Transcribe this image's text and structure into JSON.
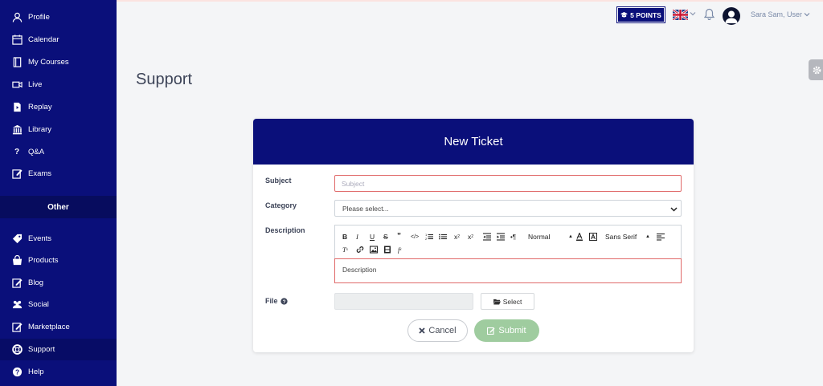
{
  "sidebar": {
    "items": [
      {
        "label": "Profile",
        "icon": "user-icon"
      },
      {
        "label": "Calendar",
        "icon": "calendar-icon"
      },
      {
        "label": "My Courses",
        "icon": "book-icon"
      },
      {
        "label": "Live",
        "icon": "video-icon"
      },
      {
        "label": "Replay",
        "icon": "replay-icon"
      },
      {
        "label": "Library",
        "icon": "library-icon"
      },
      {
        "label": "Q&A",
        "icon": "question-icon"
      },
      {
        "label": "Exams",
        "icon": "edit-icon"
      }
    ],
    "section_other": "Other",
    "other_items": [
      {
        "label": "Events",
        "icon": "tag-icon"
      },
      {
        "label": "Products",
        "icon": "products-icon"
      },
      {
        "label": "Blog",
        "icon": "blog-icon"
      },
      {
        "label": "Social",
        "icon": "users-icon"
      },
      {
        "label": "Marketplace",
        "icon": "marketplace-icon"
      },
      {
        "label": "Support",
        "icon": "lifebuoy-icon",
        "active": true
      },
      {
        "label": "Help",
        "icon": "help-icon"
      }
    ]
  },
  "topbar": {
    "points": "5 POINTS",
    "user_name": "Sara Sam, User"
  },
  "page": {
    "title": "Support"
  },
  "ticket": {
    "title": "New Ticket",
    "subject_label": "Subject",
    "subject_placeholder": "Subject",
    "category_label": "Category",
    "category_value": "Please select...",
    "description_label": "Description",
    "description_placeholder": "Description",
    "toolbar": {
      "header_format": "Normal",
      "font_family": "Sans Serif"
    },
    "file_label": "File",
    "select_label": "Select",
    "cancel_label": "Cancel",
    "submit_label": "Submit"
  },
  "colors": {
    "sidebar_bg": "#0a0f7a",
    "accent": "#0a0f7a",
    "submit": "#9fcc9f",
    "error_border": "#e06a6a"
  }
}
